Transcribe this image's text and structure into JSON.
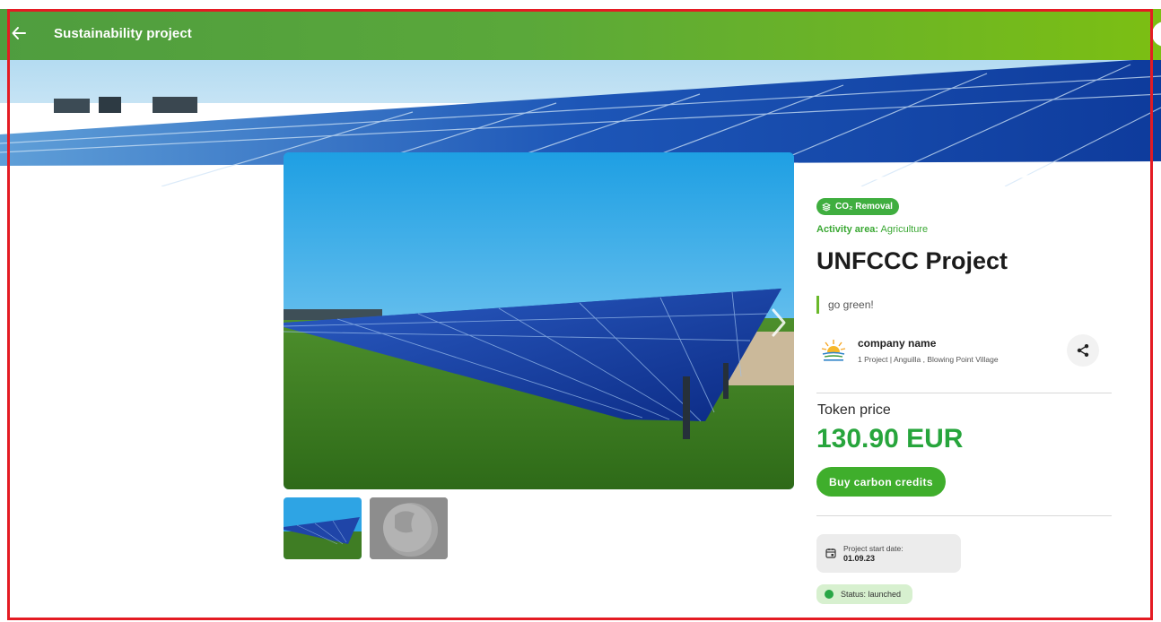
{
  "header": {
    "title": "Sustainability project",
    "back_icon": "arrow-left-icon"
  },
  "project": {
    "category_badge": "CO₂ Removal",
    "activity_label": "Activity area:",
    "activity_value": "Agriculture",
    "title": "UNFCCC Project",
    "tagline": "go green!"
  },
  "company": {
    "name": "company name",
    "meta": "1 Project | Anguilla , Blowing Point Village"
  },
  "pricing": {
    "token_label": "Token price",
    "token_price": "130.90 EUR",
    "buy_label": "Buy carbon credits"
  },
  "details": {
    "start_label": "Project start date:",
    "start_value": "01.09.23",
    "status": "Status: launched"
  },
  "gallery": {
    "thumbnails": [
      "solar-panels-thumbnail",
      "globe-thumbnail"
    ]
  },
  "colors": {
    "accent_green": "#3fae2c",
    "price_green": "#27a53c",
    "frame_red": "#e41b23"
  }
}
